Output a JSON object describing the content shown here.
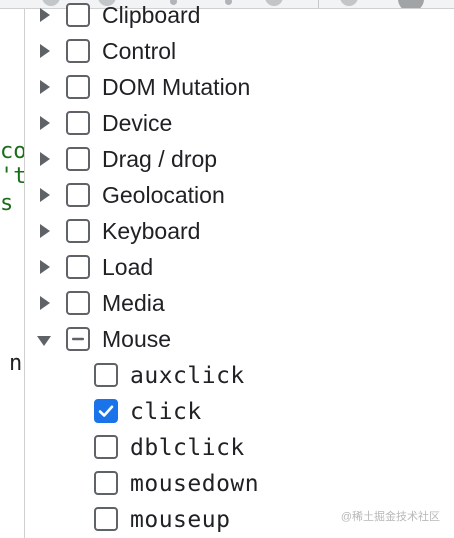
{
  "categories": [
    {
      "label": "Clipboard",
      "state": "unchecked",
      "expanded": false
    },
    {
      "label": "Control",
      "state": "unchecked",
      "expanded": false
    },
    {
      "label": "DOM Mutation",
      "state": "unchecked",
      "expanded": false
    },
    {
      "label": "Device",
      "state": "unchecked",
      "expanded": false
    },
    {
      "label": "Drag / drop",
      "state": "unchecked",
      "expanded": false
    },
    {
      "label": "Geolocation",
      "state": "unchecked",
      "expanded": false
    },
    {
      "label": "Keyboard",
      "state": "unchecked",
      "expanded": false
    },
    {
      "label": "Load",
      "state": "unchecked",
      "expanded": false
    },
    {
      "label": "Media",
      "state": "unchecked",
      "expanded": false
    },
    {
      "label": "Mouse",
      "state": "indeterminate",
      "expanded": true
    }
  ],
  "mouse_events": [
    {
      "label": "auxclick",
      "checked": false
    },
    {
      "label": "click",
      "checked": true
    },
    {
      "label": "dblclick",
      "checked": false
    },
    {
      "label": "mousedown",
      "checked": false
    },
    {
      "label": "mouseup",
      "checked": false
    }
  ],
  "code_fragments": [
    "co",
    "'t",
    "s",
    "n"
  ],
  "watermark": "@稀土掘金技术社区",
  "colors": {
    "accent": "#1a73e8",
    "code_green": "#1a6e1a",
    "text": "#202124"
  }
}
